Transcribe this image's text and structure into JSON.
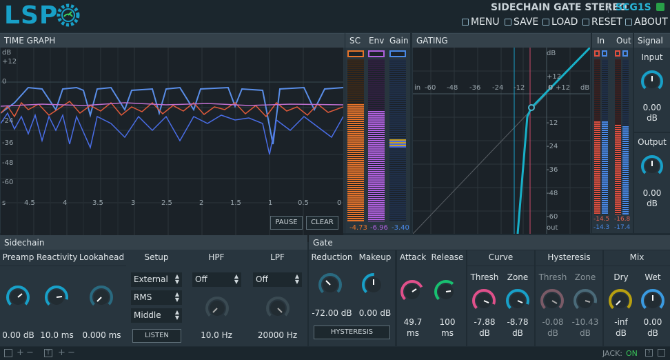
{
  "header": {
    "logo": "LSP",
    "plugin_title": "SIDECHAIN GATE STEREO",
    "plugin_code": "SCG1S",
    "menu": {
      "menu": "MENU",
      "save": "SAVE",
      "load": "LOAD",
      "reset": "RESET",
      "about": "ABOUT"
    }
  },
  "time_graph": {
    "title": "TIME GRAPH",
    "y_labels": [
      "dB",
      "+12",
      "0",
      "-12",
      "-24",
      "-36",
      "-48",
      "-60"
    ],
    "x_labels": [
      "s",
      "4.5",
      "4",
      "3.5",
      "3",
      "2.5",
      "2",
      "1.5",
      "1",
      "0.5",
      "0"
    ],
    "pause_label": "PAUSE",
    "clear_label": "CLEAR"
  },
  "meters": {
    "sc_label": "SC",
    "env_label": "Env",
    "gain_label": "Gain",
    "sc_value": "-4.73",
    "env_value": "-6.96",
    "gain_value": "-3.40"
  },
  "gating": {
    "title": "GATING",
    "x_labels": [
      "in",
      "-60",
      "-48",
      "-36",
      "-24",
      "-12",
      "0",
      "+12",
      "dB"
    ],
    "y_labels": [
      "dB",
      "+12",
      "0",
      "-12",
      "-24",
      "-36",
      "-48",
      "-60",
      "out"
    ]
  },
  "io_meters": {
    "in_label": "In",
    "out_label": "Out",
    "in_values": [
      "-14.5",
      "-14.3"
    ],
    "out_values": [
      "-16.8",
      "-17.4"
    ]
  },
  "signal": {
    "title": "Signal",
    "input_label": "Input",
    "input_value": "0.00",
    "input_unit": "dB",
    "output_label": "Output",
    "output_value": "0.00",
    "output_unit": "dB"
  },
  "sidechain": {
    "title": "Sidechain",
    "preamp_label": "Preamp",
    "reactivity_label": "Reactivity",
    "lookahead_label": "Lookahead",
    "preamp_value": "0.00 dB",
    "reactivity_value": "10.0 ms",
    "lookahead_value": "0.000 ms",
    "setup_label": "Setup",
    "setup_source": "External",
    "setup_mode": "RMS",
    "setup_channel": "Middle",
    "listen_label": "LISTEN",
    "hpf_label": "HPF",
    "hpf_mode": "Off",
    "hpf_value": "10.0 Hz",
    "lpf_label": "LPF",
    "lpf_mode": "Off",
    "lpf_value": "20000 Hz"
  },
  "gate": {
    "title": "Gate",
    "reduction_label": "Reduction",
    "makeup_label": "Makeup",
    "reduction_value": "-72.00 dB",
    "makeup_value": "0.00 dB",
    "hysteresis_button": "HYSTERESIS",
    "attack_label": "Attack",
    "release_label": "Release",
    "attack_value": "49.7",
    "attack_unit": "ms",
    "release_value": "100",
    "release_unit": "ms",
    "curve_label": "Curve",
    "curve_thresh_label": "Thresh",
    "curve_zone_label": "Zone",
    "curve_thresh_value": "-7.88",
    "curve_zone_value": "-8.78",
    "curve_unit": "dB",
    "hyst_label": "Hysteresis",
    "hyst_thresh_label": "Thresh",
    "hyst_zone_label": "Zone",
    "hyst_thresh_value": "-0.08",
    "hyst_zone_value": "-10.43",
    "hyst_unit": "dB",
    "mix_label": "Mix",
    "dry_label": "Dry",
    "wet_label": "Wet",
    "dry_value": "-inf",
    "dry_unit": "dB",
    "wet_value": "0.00",
    "wet_unit": "dB"
  },
  "footer": {
    "jack_label": "JACK:",
    "jack_status": "ON"
  },
  "colors": {
    "accent": "#18a0c8",
    "sc": "#e8742a",
    "env": "#b161e0",
    "gain": "#4a8ae8",
    "pink": "#e0508a",
    "green": "#18c070",
    "yellow": "#b8a010",
    "blue": "#3a9ae0",
    "grey": "#8a8a8a"
  }
}
